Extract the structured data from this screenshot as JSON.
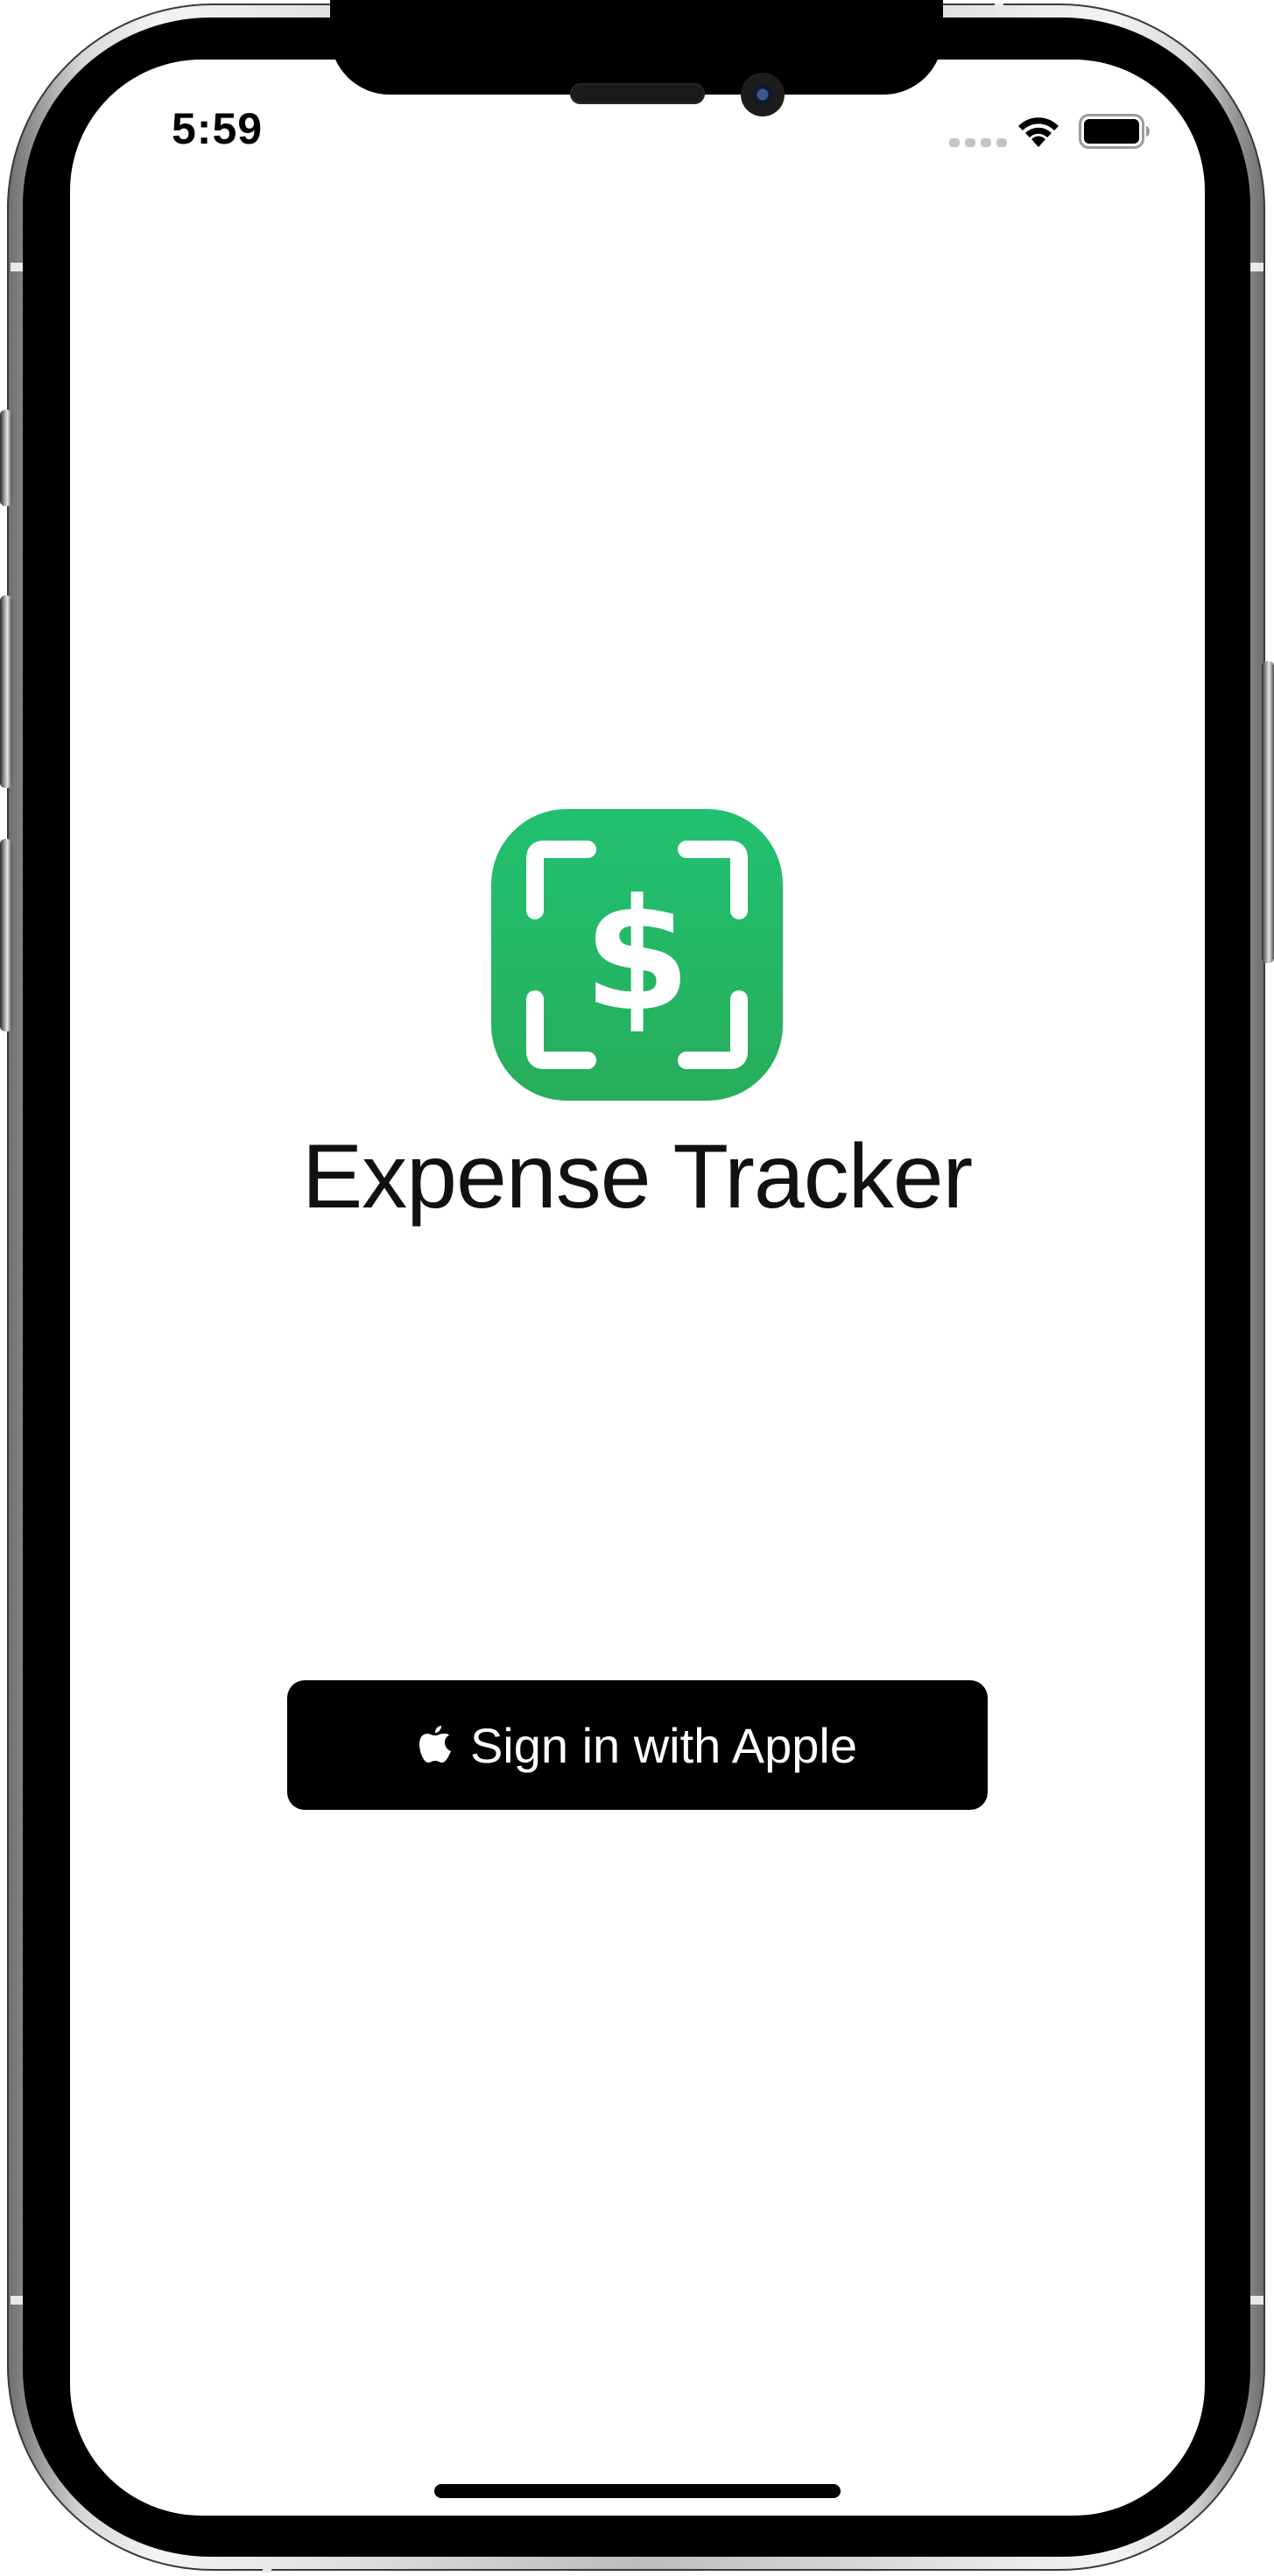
{
  "status_bar": {
    "time": "5:59",
    "wifi_icon": "wifi-icon",
    "battery_icon": "battery-icon",
    "signal_icon": "cellular-signal-icon"
  },
  "app": {
    "icon": "dollar-scan-icon",
    "icon_color": "#22b866",
    "title": "Expense Tracker"
  },
  "sign_in": {
    "icon": "apple-logo-icon",
    "label": "Sign in with Apple",
    "background_color": "#000000",
    "text_color": "#ffffff"
  }
}
